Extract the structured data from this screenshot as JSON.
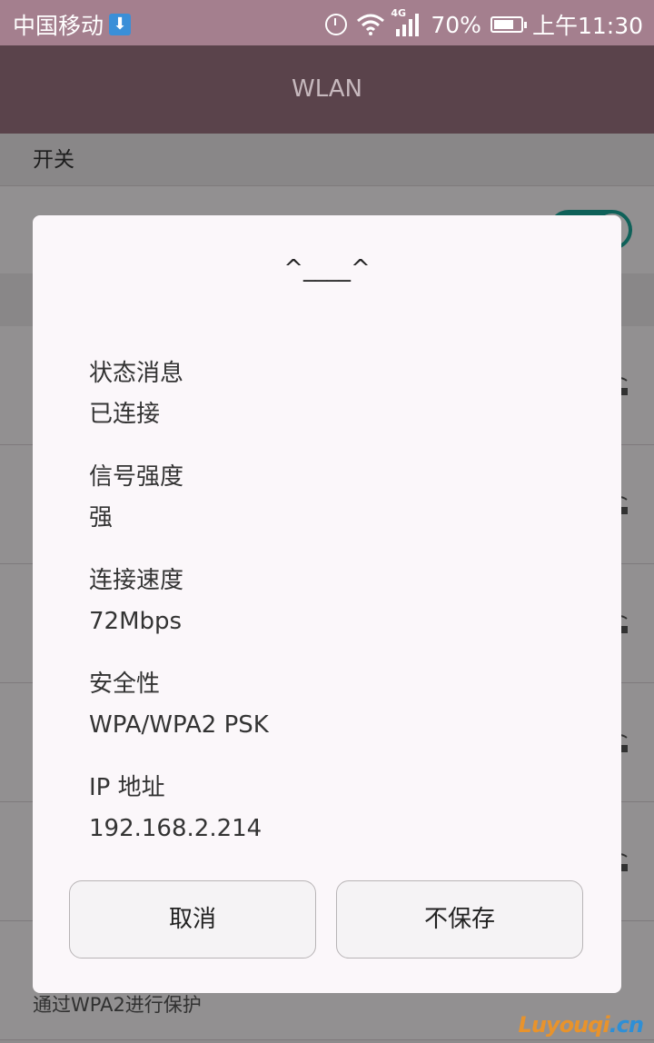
{
  "statusbar": {
    "carrier": "中国移动",
    "network_type": "4G",
    "battery": "70%",
    "time": "上午11:30",
    "icons": [
      "download-icon",
      "alarm-icon",
      "wifi-icon",
      "signal-icon",
      "battery-icon"
    ]
  },
  "appbar": {
    "title": "WLAN"
  },
  "background": {
    "section_head": "开关",
    "toggle_on": true,
    "last_row_text": "通过WPA2进行保护"
  },
  "dialog": {
    "title": "^____^",
    "items": [
      {
        "label": "状态消息",
        "value": "已连接"
      },
      {
        "label": "信号强度",
        "value": "强"
      },
      {
        "label": "连接速度",
        "value": "72Mbps"
      },
      {
        "label": "安全性",
        "value": "WPA/WPA2 PSK"
      },
      {
        "label": "IP 地址",
        "value": "192.168.2.214"
      }
    ],
    "cancel_label": "取消",
    "nosave_label": "不保存"
  },
  "watermark": {
    "part1": "Luyouqi",
    "part2": ".cn"
  },
  "colors": {
    "statusbar": "#a47f8e",
    "appbar": "#5a434b",
    "toggle": "#1aa79a"
  }
}
